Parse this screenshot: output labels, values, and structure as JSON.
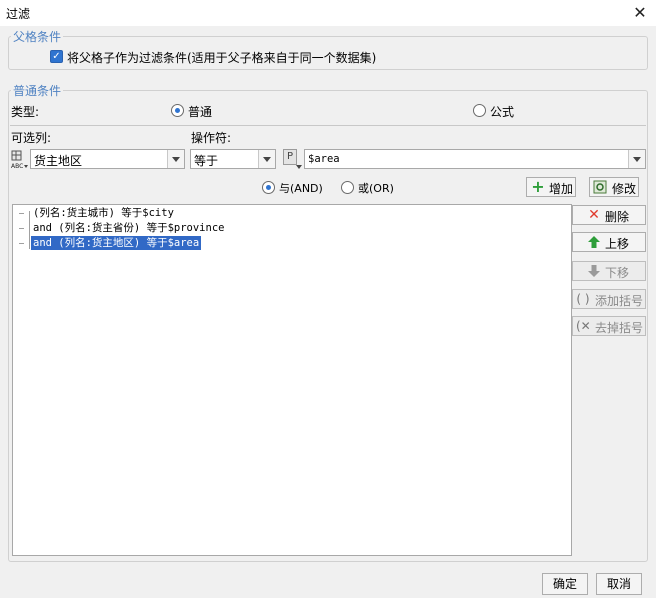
{
  "window": {
    "title": "过滤",
    "close_glyph": "✕"
  },
  "parent_group": {
    "legend": "父格条件",
    "checkbox_label": "将父格子作为过滤条件(适用于父子格来自于同一个数据集)",
    "checkbox_checked": true
  },
  "normal_group": {
    "legend": "普通条件",
    "type_label": "类型:",
    "radio_normal": "普通",
    "radio_formula": "公式",
    "selected_type": "普通",
    "column_label": "可选列:",
    "operator_label": "操作符:",
    "column_value": "货主地区",
    "operator_value": "等于",
    "param_icon_text": "P",
    "value_text": "$area",
    "logic_and": "与(AND)",
    "logic_or": "或(OR)",
    "selected_logic": "与(AND)",
    "add_button": "增加",
    "modify_button": "修改"
  },
  "conditions": [
    {
      "text": "(列名:货主城市) 等于$city",
      "selected": false
    },
    {
      "text": "and (列名:货主省份) 等于$province",
      "selected": false
    },
    {
      "text": "and (列名:货主地区) 等于$area",
      "selected": true
    }
  ],
  "side_buttons": {
    "delete": "删除",
    "move_up": "上移",
    "move_down": "下移",
    "add_paren": "添加括号",
    "remove_paren": "去掉括号"
  },
  "footer": {
    "ok": "确定",
    "cancel": "取消"
  },
  "colors": {
    "accent": "#2f74d0",
    "legend": "#4f82c2",
    "selection": "#3169c6",
    "delete_red": "#e03b2e",
    "up_green": "#2e9e3a"
  }
}
